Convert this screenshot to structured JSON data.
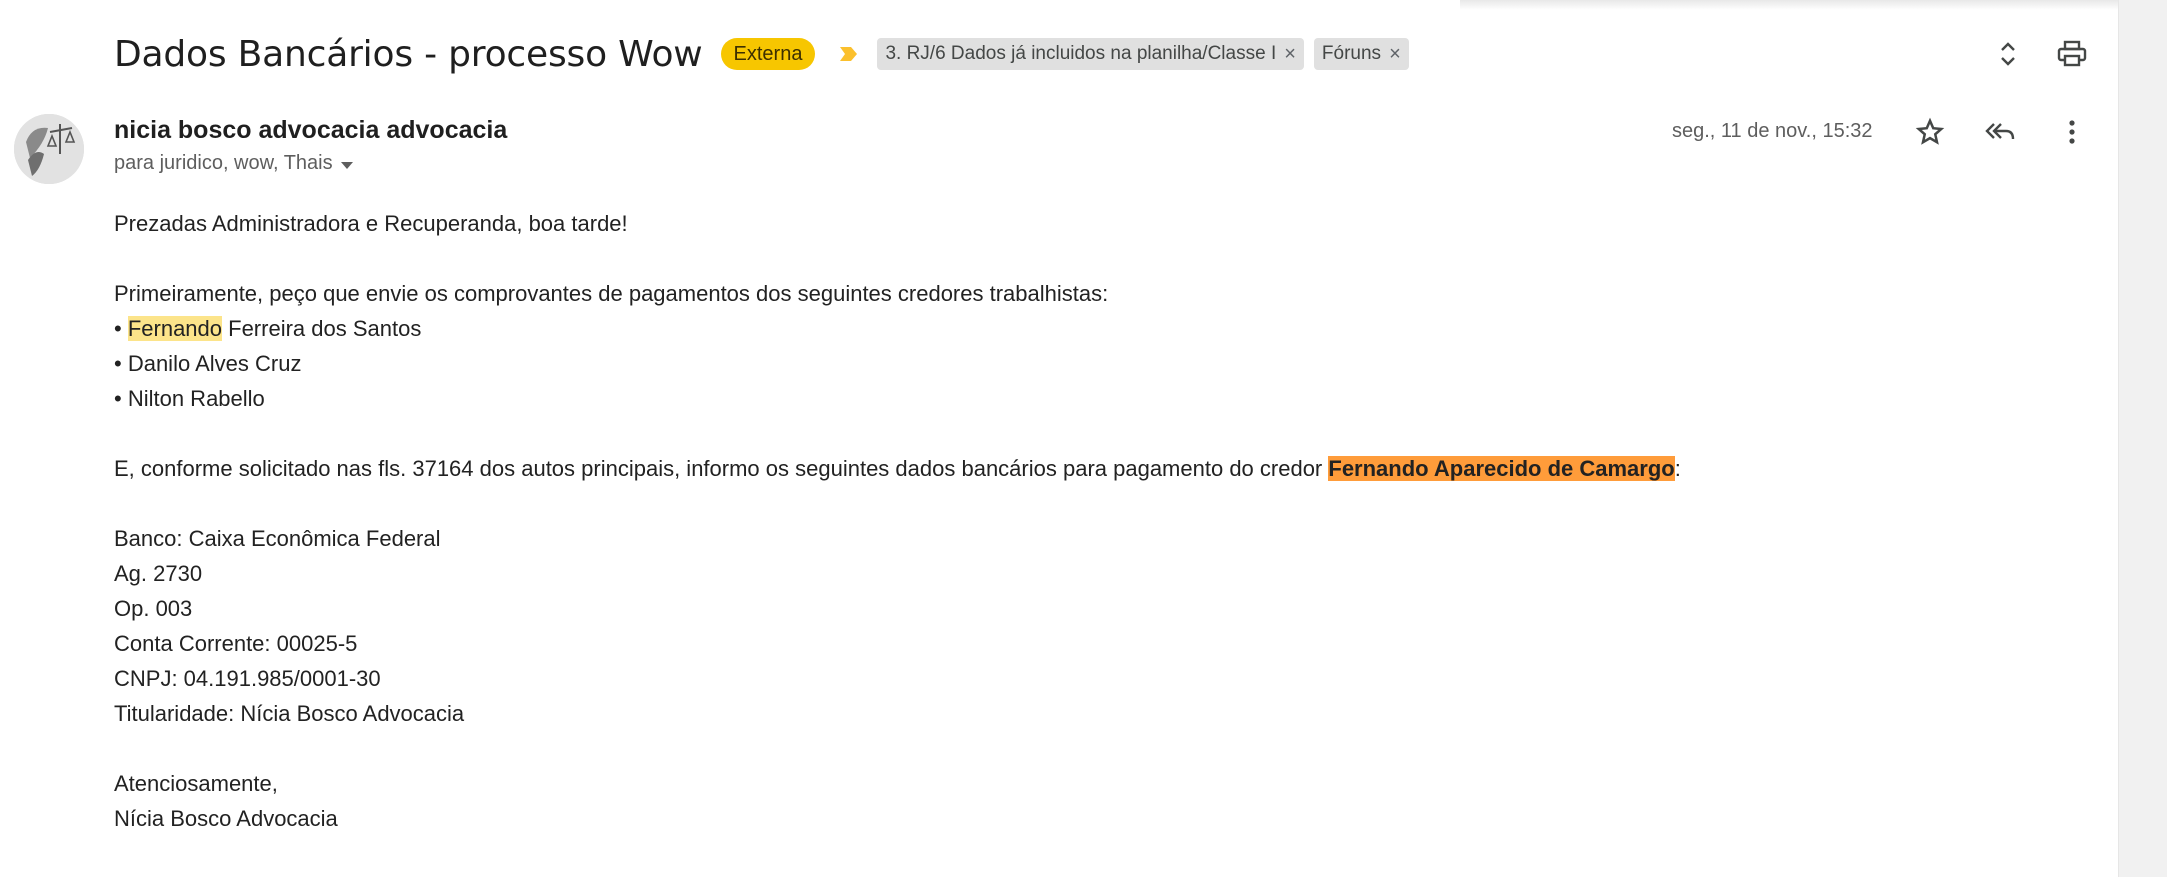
{
  "email": {
    "subject": "Dados Bancários - processo Wow",
    "labels": {
      "external": "Externa",
      "chips": [
        {
          "text": "3. RJ/6 Dados já incluidos na planilha/Classe I",
          "close": "×"
        },
        {
          "text": "Fóruns",
          "close": "×"
        }
      ]
    },
    "sender": "nicia bosco advocacia advocacia",
    "recipients": "para juridico, wow, Thais",
    "date": "seg., 11 de nov., 15:32",
    "icons": {
      "expand": "unfold-icon",
      "print": "print-icon",
      "star": "star-icon",
      "reply_all": "reply-all-icon",
      "more": "more-vert-icon",
      "importance": "importance-marker-icon",
      "avatar": "justice-scale-avatar"
    },
    "colors": {
      "external_label": "#f7c600",
      "importance_marker": "#fbc02d",
      "highlight_yellow": "#fce48a",
      "highlight_orange": "#ff9c3a"
    },
    "body": {
      "greeting": "Prezadas Administradora e Recuperanda, boa tarde!",
      "intro": "Primeiramente, peço que envie os comprovantes de pagamentos dos seguintes credores trabalhistas:",
      "creditors": [
        {
          "bullet": "• ",
          "highlight": "Fernando",
          "rest": " Ferreira dos Santos"
        },
        {
          "bullet": "• ",
          "text": "Danilo Alves Cruz"
        },
        {
          "bullet": "• ",
          "text": "Nilton Rabello"
        }
      ],
      "request_prefix": "E, conforme solicitado nas fls. 37164 dos autos principais, informo os seguintes dados bancários para pagamento do credor ",
      "request_name": "Fernando Aparecido de Camargo",
      "request_suffix": ":",
      "bank": [
        "Banco: Caixa Econômica Federal",
        "Ag. 2730",
        "Op. 003",
        "Conta Corrente: 00025-5",
        "CNPJ: 04.191.985/0001-30",
        "Titularidade: Nícia Bosco Advocacia"
      ],
      "closing": "Atenciosamente,",
      "signature": "Nícia Bosco Advocacia"
    }
  }
}
